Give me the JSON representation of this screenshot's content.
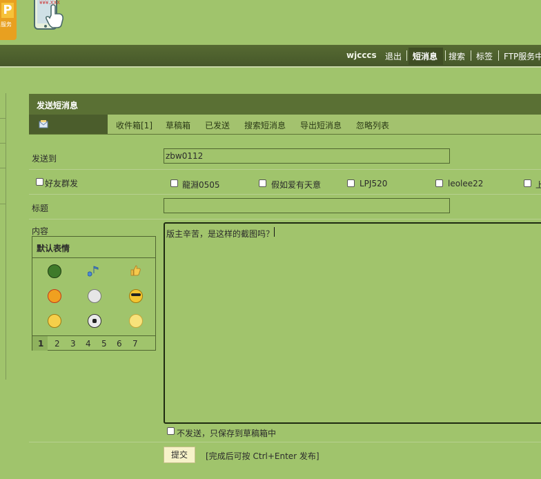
{
  "header": {
    "logo_letter": "P",
    "logo_text": "服务",
    "phone_caption": "¥¥¥.XXX"
  },
  "nav": {
    "username": "wjcccs",
    "items": [
      "退出",
      "短消息",
      "搜索",
      "标签",
      "FTP服务中"
    ],
    "active": "短消息"
  },
  "panel": {
    "title": "发送短消息",
    "tabs": [
      "收件箱[1]",
      "草稿箱",
      "已发送",
      "搜索短消息",
      "导出短消息",
      "忽略列表"
    ]
  },
  "form": {
    "send_to_label": "发送到",
    "send_to_value": "zbw0112",
    "friend_group_label": "好友群发",
    "friends": [
      "龍淵0505",
      "假如爱有天意",
      "LPJ520",
      "leolee22",
      "上"
    ],
    "subject_label": "标题",
    "subject_value": "",
    "content_label": "内容",
    "content_value": "版主辛苦，是这样的截图吗？",
    "smiley_title": "默认表情",
    "smiley_pages": [
      "1",
      "2",
      "3",
      "4",
      "5",
      "6",
      "7"
    ],
    "draft_label": "不发送，只保存到草稿箱中",
    "submit_label": "提交",
    "hint": "[完成后可按 Ctrl+Enter 发布]"
  },
  "smileys": [
    "turtle-icon",
    "music-note-icon",
    "thumbs-up-icon",
    "angry-face-icon",
    "skull-icon",
    "sunglasses-face-icon",
    "smirk-face-icon",
    "soccer-ball-icon",
    "shy-face-icon"
  ]
}
